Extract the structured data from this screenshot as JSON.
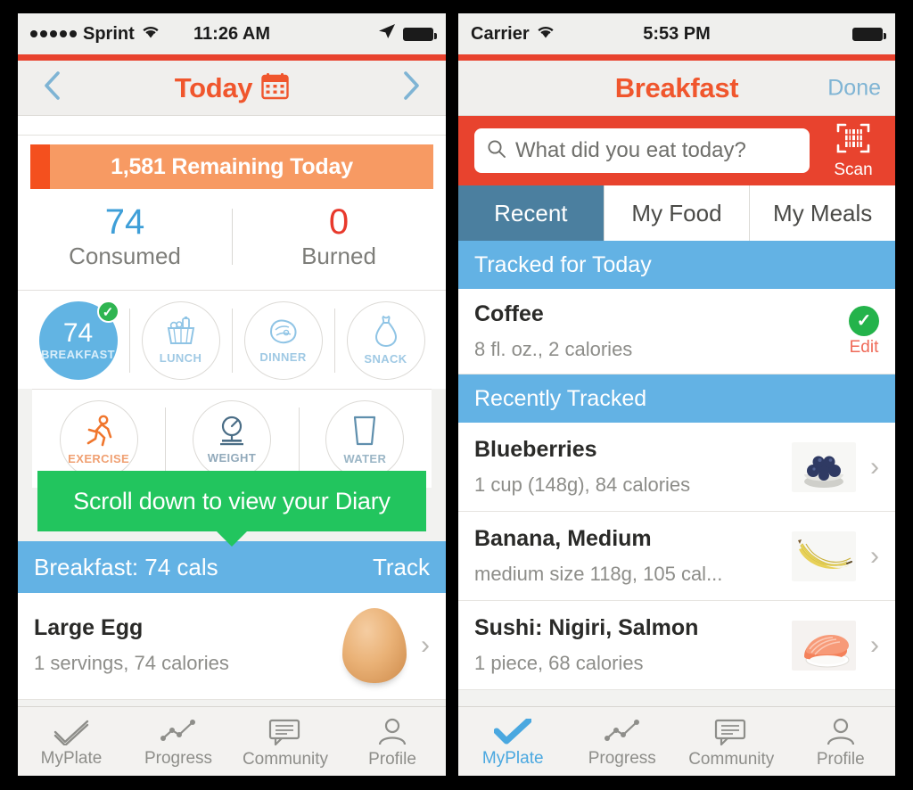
{
  "left_phone": {
    "status_bar": {
      "carrier": "Sprint",
      "signal_icon": "signal-dots-icon",
      "wifi_icon": "wifi-icon",
      "time": "11:26 AM",
      "location_icon": "location-arrow-icon",
      "battery_icon": "battery-icon"
    },
    "nav": {
      "back_icon": "chevron-left-icon",
      "title": "Today",
      "calendar_icon": "calendar-icon",
      "forward_icon": "chevron-right-icon"
    },
    "summary": {
      "remaining_text": "1,581 Remaining Today",
      "remaining_value": 1581,
      "consumed_value": "74",
      "consumed_label": "Consumed",
      "burned_value": "0",
      "burned_label": "Burned"
    },
    "meals": [
      {
        "label": "BREAKFAST",
        "value": "74",
        "active": true,
        "checked": true,
        "icon": "breakfast-icon"
      },
      {
        "label": "LUNCH",
        "value": "",
        "active": false,
        "checked": false,
        "icon": "lunch-basket-icon"
      },
      {
        "label": "DINNER",
        "value": "",
        "active": false,
        "checked": false,
        "icon": "dinner-plate-icon"
      },
      {
        "label": "SNACK",
        "value": "",
        "active": false,
        "checked": false,
        "icon": "snack-bag-icon"
      }
    ],
    "activities": [
      {
        "label": "EXERCISE",
        "icon": "running-person-icon"
      },
      {
        "label": "WEIGHT",
        "icon": "scale-icon"
      },
      {
        "label": "WATER",
        "icon": "water-glass-icon"
      }
    ],
    "tooltip": {
      "text": "Scroll down to view your Diary"
    },
    "meal_bar": {
      "title": "Breakfast: 74 cals",
      "action": "Track"
    },
    "food_entry": {
      "name": "Large Egg",
      "detail": "1 servings, 74 calories",
      "thumb_icon": "egg-photo",
      "chevron_icon": "chevron-right-icon"
    },
    "tabs": [
      {
        "label": "MyPlate",
        "icon": "check-plate-icon",
        "active": false
      },
      {
        "label": "Progress",
        "icon": "progress-chart-icon",
        "active": false
      },
      {
        "label": "Community",
        "icon": "community-chat-icon",
        "active": false
      },
      {
        "label": "Profile",
        "icon": "profile-person-icon",
        "active": false
      }
    ]
  },
  "right_phone": {
    "status_bar": {
      "carrier": "Carrier",
      "wifi_icon": "wifi-icon",
      "time": "5:53 PM",
      "battery_icon": "battery-icon"
    },
    "nav": {
      "title": "Breakfast",
      "done_label": "Done"
    },
    "search": {
      "placeholder": "What did you eat today?",
      "value": "",
      "search_icon": "search-icon",
      "scan_label": "Scan",
      "scan_icon": "barcode-scan-icon"
    },
    "segments": [
      {
        "label": "Recent",
        "active": true
      },
      {
        "label": "My Food",
        "active": false
      },
      {
        "label": "My Meals",
        "active": false
      }
    ],
    "sections": [
      {
        "header": "Tracked for Today",
        "items": [
          {
            "name": "Coffee",
            "detail": "8 fl. oz., 2 calories",
            "kind": "tracked",
            "check_icon": "check-circle-icon",
            "edit_label": "Edit"
          }
        ]
      },
      {
        "header": "Recently Tracked",
        "items": [
          {
            "name": "Blueberries",
            "detail": "1 cup (148g), 84 calories",
            "kind": "recent",
            "thumb_icon": "blueberries-photo",
            "chevron_icon": "chevron-right-icon"
          },
          {
            "name": "Banana, Medium",
            "detail": "medium size 118g, 105 cal...",
            "kind": "recent",
            "thumb_icon": "banana-photo",
            "chevron_icon": "chevron-right-icon"
          },
          {
            "name": "Sushi: Nigiri, Salmon",
            "detail": "1 piece, 68 calories",
            "kind": "recent",
            "thumb_icon": "sushi-photo",
            "chevron_icon": "chevron-right-icon"
          }
        ]
      }
    ],
    "tabs": [
      {
        "label": "MyPlate",
        "icon": "check-plate-icon",
        "active": true
      },
      {
        "label": "Progress",
        "icon": "progress-chart-icon",
        "active": false
      },
      {
        "label": "Community",
        "icon": "community-chat-icon",
        "active": false
      },
      {
        "label": "Profile",
        "icon": "profile-person-icon",
        "active": false
      }
    ]
  },
  "colors": {
    "brand_red": "#e8432e",
    "brand_orange": "#f0562d",
    "bar_orange": "#f79a63",
    "bar_orange_fill": "#f4501e",
    "blue": "#63b2e4",
    "blue_dark": "#4b7f9f",
    "green_tooltip": "#22c55e",
    "green_check": "#24b34b",
    "link_blue": "#7fb4d4",
    "consumed_blue": "#3f9fd8",
    "burned_red": "#e8392c"
  }
}
